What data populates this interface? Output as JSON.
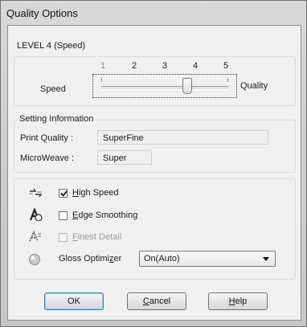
{
  "window": {
    "title": "Quality Options"
  },
  "level": {
    "label": "LEVEL 4 (Speed)"
  },
  "slider": {
    "ticks": [
      "1",
      "2",
      "3",
      "4",
      "5"
    ],
    "left_label": "Speed",
    "right_label": "Quality",
    "selected_level": 4
  },
  "setting_info": {
    "legend": "Setting Information",
    "print_quality_label": "Print Quality :",
    "print_quality_value": "SuperFine",
    "microweave_label": "MicroWeave :",
    "microweave_value": "Super"
  },
  "options": {
    "high_speed": {
      "pre": "",
      "key": "H",
      "post": "igh Speed",
      "checked": true,
      "enabled": true,
      "icon": "high-speed-icon"
    },
    "edge_smoothing": {
      "pre": "",
      "key": "E",
      "post": "dge Smoothing",
      "checked": false,
      "enabled": true,
      "icon": "edge-smoothing-icon"
    },
    "finest_detail": {
      "pre": "",
      "key": "F",
      "post": "inest Detail",
      "checked": false,
      "enabled": false,
      "icon": "finest-detail-icon"
    },
    "gloss_optimizer": {
      "pre": "Gloss Optimi",
      "key": "z",
      "post": "er",
      "value": "On(Auto)",
      "icon": "gloss-optimizer-icon"
    }
  },
  "buttons": {
    "ok": {
      "pre": "OK",
      "key": "",
      "post": ""
    },
    "cancel": {
      "pre": "",
      "key": "C",
      "post": "ancel"
    },
    "help": {
      "pre": "",
      "key": "H",
      "post": "elp"
    }
  },
  "colors": {
    "default_button_border": "#3c7fb1",
    "dialog_background": "#f0f0f0"
  }
}
